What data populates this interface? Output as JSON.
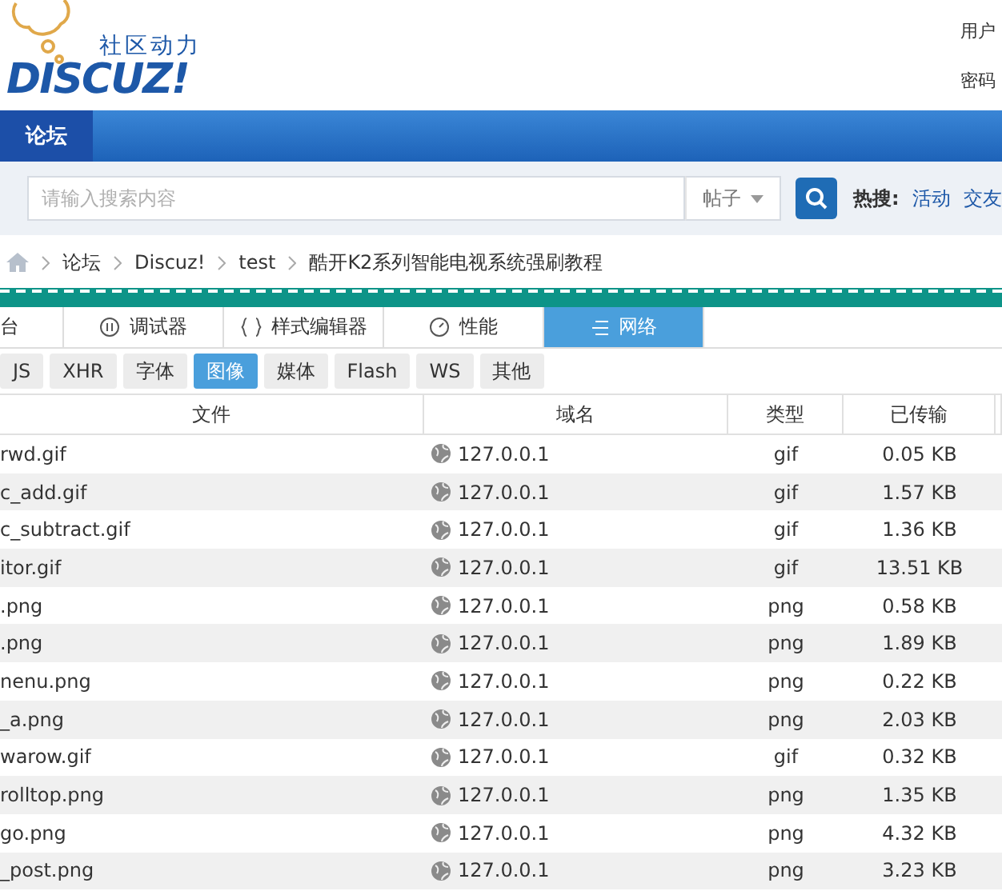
{
  "header": {
    "tagline": "社区动力",
    "logo_text": "DISCUZ!",
    "login_labels": [
      "用户",
      "密码"
    ]
  },
  "nav": {
    "items": [
      {
        "label": "论坛",
        "selected": true
      }
    ]
  },
  "search": {
    "placeholder": "请输入搜索内容",
    "scope": "帖子",
    "hot_label": "热搜:",
    "hot_links": [
      "活动",
      "交友"
    ]
  },
  "breadcrumb": [
    "论坛",
    "Discuz!",
    "test",
    "酷开K2系列智能电视系统强刷教程"
  ],
  "devtools": {
    "tabs": [
      {
        "label": "台",
        "kind": "console",
        "selected": false
      },
      {
        "label": "调试器",
        "kind": "debugger",
        "selected": false
      },
      {
        "label": "样式编辑器",
        "kind": "style",
        "selected": false
      },
      {
        "label": "性能",
        "kind": "performance",
        "selected": false
      },
      {
        "label": "网络",
        "kind": "network",
        "selected": true
      }
    ],
    "filters": [
      {
        "label": "JS",
        "selected": false
      },
      {
        "label": "XHR",
        "selected": false
      },
      {
        "label": "字体",
        "selected": false
      },
      {
        "label": "图像",
        "selected": true
      },
      {
        "label": "媒体",
        "selected": false
      },
      {
        "label": "Flash",
        "selected": false
      },
      {
        "label": "WS",
        "selected": false
      },
      {
        "label": "其他",
        "selected": false
      }
    ],
    "table": {
      "columns": [
        "文件",
        "域名",
        "类型",
        "已传输"
      ],
      "rows": [
        {
          "file": "rwd.gif",
          "domain": "127.0.0.1",
          "type": "gif",
          "transferred": "0.05 KB"
        },
        {
          "file": "c_add.gif",
          "domain": "127.0.0.1",
          "type": "gif",
          "transferred": "1.57 KB"
        },
        {
          "file": "c_subtract.gif",
          "domain": "127.0.0.1",
          "type": "gif",
          "transferred": "1.36 KB"
        },
        {
          "file": "itor.gif",
          "domain": "127.0.0.1",
          "type": "gif",
          "transferred": "13.51 KB"
        },
        {
          "file": ".png",
          "domain": "127.0.0.1",
          "type": "png",
          "transferred": "0.58 KB"
        },
        {
          "file": ".png",
          "domain": "127.0.0.1",
          "type": "png",
          "transferred": "1.89 KB"
        },
        {
          "file": "nenu.png",
          "domain": "127.0.0.1",
          "type": "png",
          "transferred": "0.22 KB"
        },
        {
          "file": "_a.png",
          "domain": "127.0.0.1",
          "type": "png",
          "transferred": "2.03 KB"
        },
        {
          "file": "warow.gif",
          "domain": "127.0.0.1",
          "type": "gif",
          "transferred": "0.32 KB"
        },
        {
          "file": "rolltop.png",
          "domain": "127.0.0.1",
          "type": "png",
          "transferred": "1.35 KB"
        },
        {
          "file": "go.png",
          "domain": "127.0.0.1",
          "type": "png",
          "transferred": "4.32 KB"
        },
        {
          "file": "_post.png",
          "domain": "127.0.0.1",
          "type": "png",
          "transferred": "3.23 KB"
        }
      ]
    }
  }
}
